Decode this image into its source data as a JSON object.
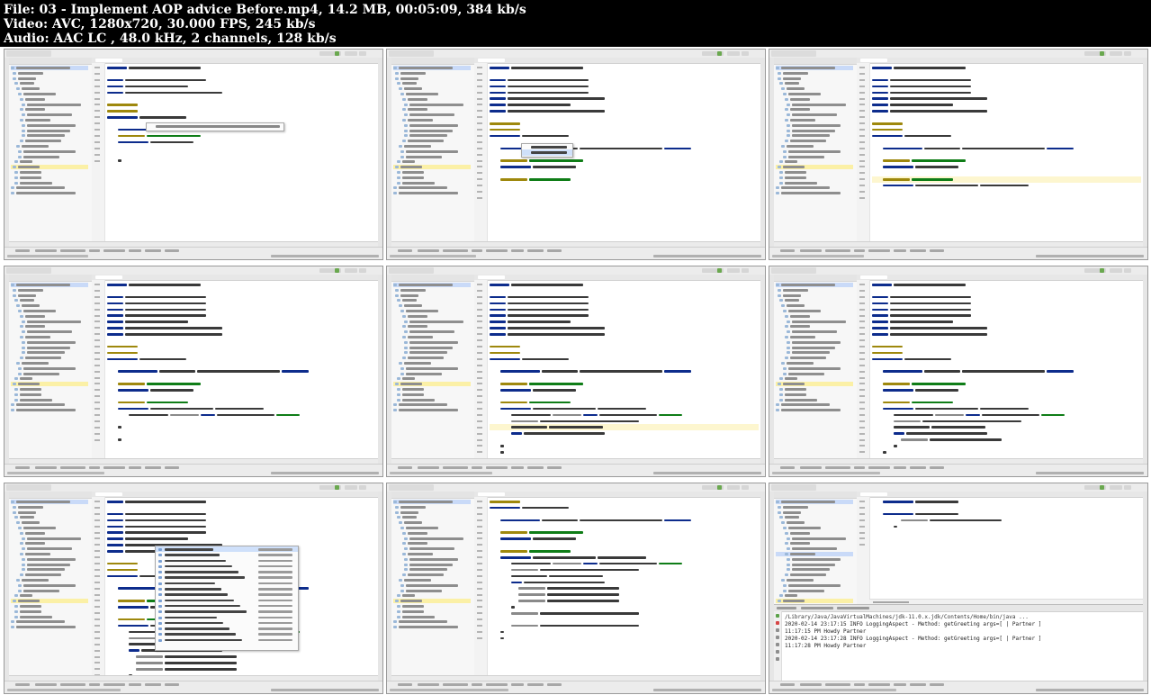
{
  "header": {
    "file_line": "File: 03 - Implement AOP advice Before.mp4, 14.2 MB, 00:05:09, 384 kb/s",
    "video_line": "Video: AVC, 1280x720, 30.000 FPS, 245 kb/s",
    "audio_line": "Audio: AAC LC , 48.0 kHz, 2 channels, 128 kb/s"
  },
  "thumbnails": [
    {
      "index": 1,
      "editor_file": "LoggingAspect.java"
    },
    {
      "index": 2,
      "editor_file": "LoggingAspect.java"
    },
    {
      "index": 3,
      "editor_file": "LoggingAspect.java"
    },
    {
      "index": 4,
      "editor_file": "LoggingAspect.java"
    },
    {
      "index": 5,
      "editor_file": "LoggingAspect.java"
    },
    {
      "index": 6,
      "editor_file": "LoggingAspect.java"
    },
    {
      "index": 7,
      "editor_file": "LoggingAspect.java"
    },
    {
      "index": 8,
      "editor_file": "LoggingAspect.java"
    },
    {
      "index": 9,
      "editor_file": "GreetingService.java"
    }
  ],
  "console": {
    "lines": [
      "/Library/Java/JavaVirtualMachines/jdk-11.0.x.jdk/Contents/Home/bin/java ...",
      "2020-02-14 23:17:15 INFO  LoggingAspect - Method: getGreeting args=[ | Partner ]",
      "11:17:15 PM Howdy Partner",
      "2020-02-14 23:17:28 INFO  LoggingAspect - Method: getGreeting args=[ | Partner ]",
      "11:17:28 PM Howdy Partner"
    ]
  },
  "colors": {
    "header_bg": "#000000",
    "header_text": "#ffffff",
    "keyword": "#0d2c8c",
    "annotation": "#9e880d",
    "string": "#0f7d17",
    "selection": "#c9daf8"
  }
}
